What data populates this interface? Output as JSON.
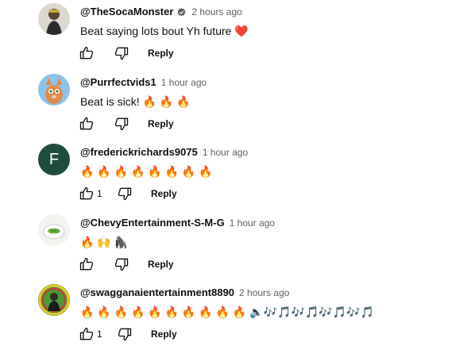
{
  "reply_label": "Reply",
  "comments": [
    {
      "author": "@TheSocaMonster",
      "verified": true,
      "time": "2 hours ago",
      "text": "Beat saying lots bout Yh future ❤️",
      "likes": "",
      "avatar_color": "#d9d4cc"
    },
    {
      "author": "@Purrfectvids1",
      "verified": false,
      "time": "1 hour ago",
      "text": "Beat is sick! 🔥 🔥 🔥",
      "likes": "",
      "avatar_color": "#7ab8e0"
    },
    {
      "author": "@frederickrichards9075",
      "verified": false,
      "time": "1 hour ago",
      "text": "🔥 🔥 🔥 🔥 🔥 🔥 🔥 🔥",
      "likes": "1",
      "avatar_color": "#1e4d3c",
      "avatar_letter": "F"
    },
    {
      "author": "@ChevyEntertainment-S-M-G",
      "verified": false,
      "time": "1 hour ago",
      "text": "🔥 🙌 🦍",
      "likes": "",
      "avatar_color": "#eef2ea"
    },
    {
      "author": "@swagganaientertainment8890",
      "verified": false,
      "time": "2 hours ago",
      "text": "🔥 🔥 🔥 🔥 🔥 🔥 🔥 🔥 🔥 🔥 🔉🎶🎵🎶🎵🎶🎵🎶🎵",
      "likes": "1",
      "avatar_color": "#3a8a3a"
    }
  ]
}
